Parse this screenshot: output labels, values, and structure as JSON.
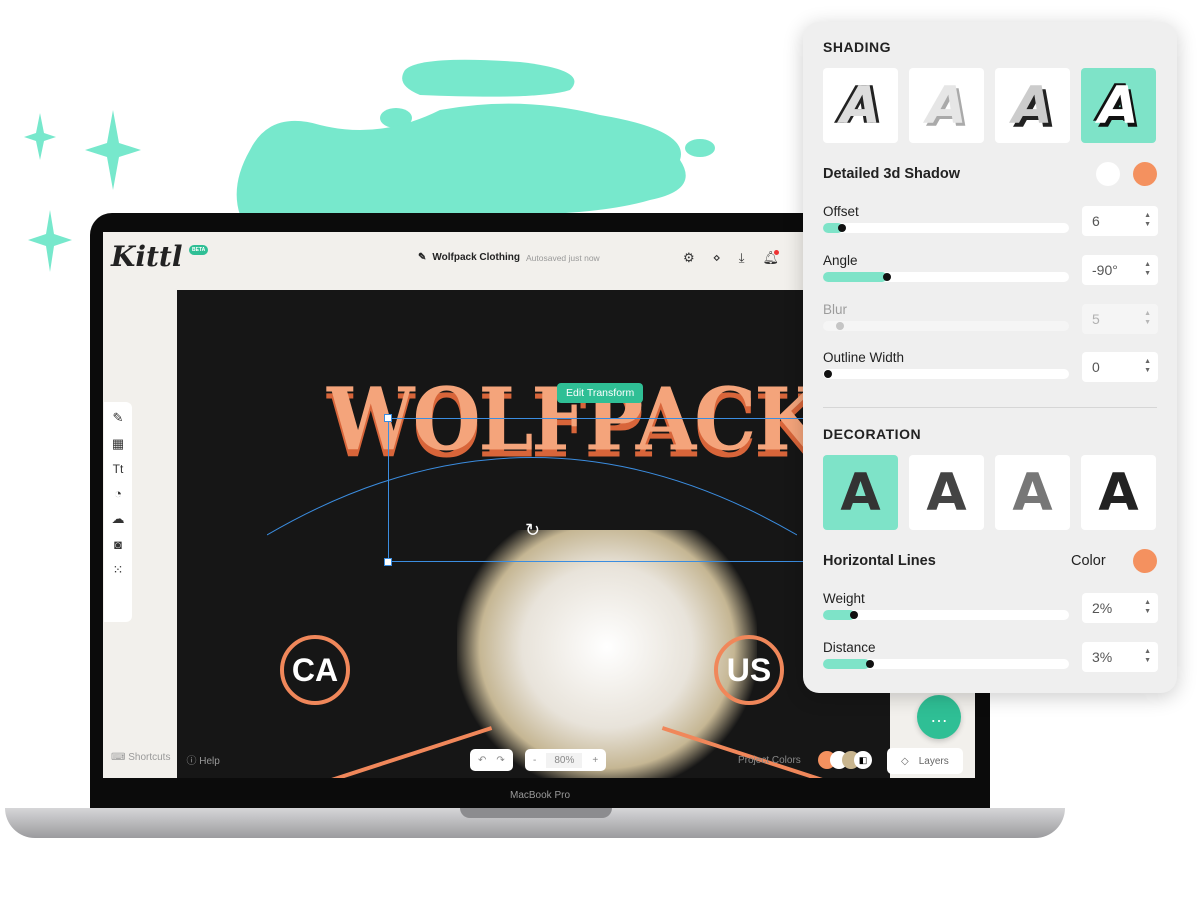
{
  "app": {
    "logo": "Kittl",
    "badge": "BETA",
    "doc_title": "Wolfpack Clothing",
    "autosave": "Autosaved just now"
  },
  "canvas": {
    "edit_transform": "Edit Transform",
    "headline": "WOLFPACK",
    "left_badge": "CA",
    "right_badge": "US"
  },
  "bottom": {
    "shortcuts": "Shortcuts",
    "help": "Help",
    "zoom": "80%",
    "zoom_minus": "-",
    "zoom_plus": "+",
    "undo": "↶",
    "redo": "↷",
    "project_colors": "Project Colors",
    "layers": "Layers"
  },
  "device": "MacBook Pro",
  "panel": {
    "shading_title": "SHADING",
    "shading_selected": 3,
    "shadow_label": "Detailed 3d Shadow",
    "shadow_colors": [
      "#ffffff",
      "#f4915f"
    ],
    "sliders": [
      {
        "label": "Offset",
        "value": "6",
        "fill": 0.08,
        "disabled": false
      },
      {
        "label": "Angle",
        "value": "-90°",
        "fill": 0.26,
        "disabled": false
      },
      {
        "label": "Blur",
        "value": "5",
        "fill": 0.07,
        "disabled": true
      },
      {
        "label": "Outline Width",
        "value": "0",
        "fill": 0.02,
        "disabled": false
      }
    ],
    "decoration_title": "DECORATION",
    "decoration_selected": 0,
    "lines_label": "Horizontal Lines",
    "color_label": "Color",
    "lines_color": "#f4915f",
    "sliders2": [
      {
        "label": "Weight",
        "value": "2%",
        "fill": 0.13
      },
      {
        "label": "Distance",
        "value": "3%",
        "fill": 0.19
      }
    ]
  },
  "colors": {
    "accent": "#2fbf95",
    "mint": "#7ee3c8",
    "orange": "#f4915f",
    "blob": "#77e8cc"
  }
}
